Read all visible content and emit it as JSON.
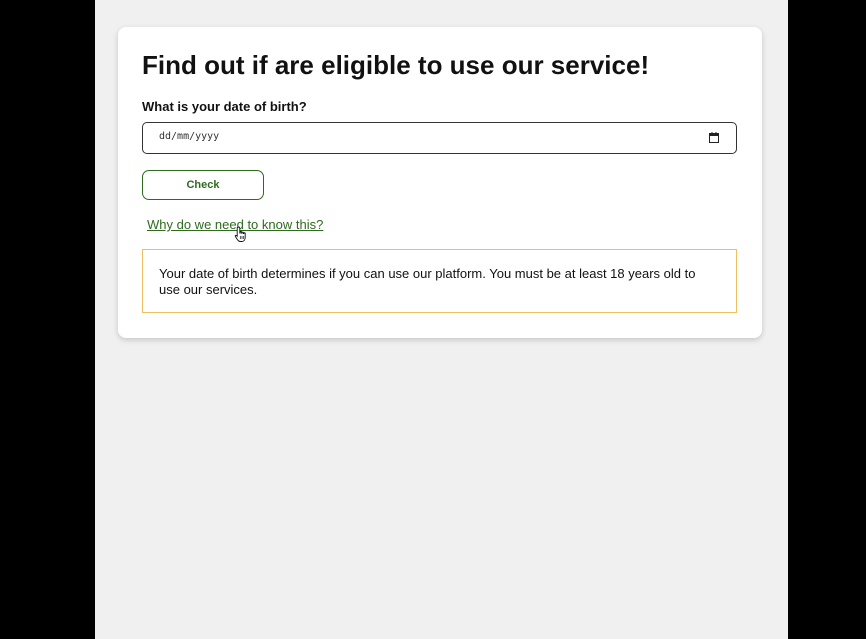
{
  "page": {
    "title": "Find out if are eligible to use our service!"
  },
  "form": {
    "dob_label": "What is your date of birth?",
    "dob_placeholder": "dd/mm/yyyy",
    "dob_value": "",
    "dob_icon": "calendar-icon",
    "check_label": "Check"
  },
  "help": {
    "link_text": "Why do we need to know this?",
    "explanation": "Your date of birth determines if you can use our platform. You must be at least 18 years old to use our services."
  },
  "colors": {
    "accent": "#2e6b1f",
    "info_border": "#f0c060",
    "page_background": "#f0f0f0"
  }
}
